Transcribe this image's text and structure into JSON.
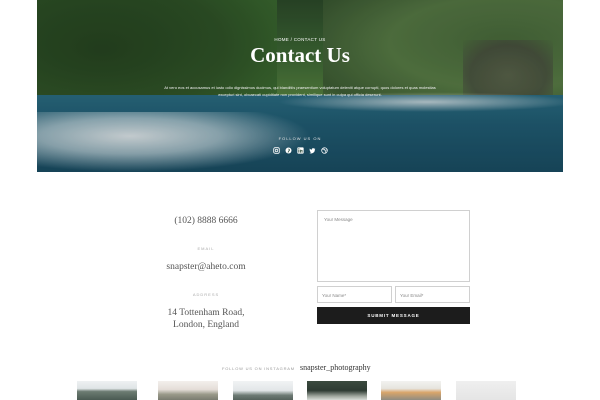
{
  "hero": {
    "breadcrumb": "HOME / CONTACT US",
    "title": "Contact Us",
    "intro": "At vero eos et accusamus et iusto odio dignissimos ducimus, qui blanditiis praesentium voluptatum deleniti atque corrupti, quos dolores et quas molestias excepturi sint, obcaecati cupiditate non provident, similique sunt in culpa qui officia deserunt.",
    "follow_label": "FOLLOW US ON",
    "socials": [
      "instagram-icon",
      "pinterest-icon",
      "linkedin-icon",
      "twitter-icon",
      "dribbble-icon"
    ]
  },
  "contact": {
    "phone": "(102) 8888 6666",
    "email_label": "EMAIL",
    "email": "snapster@aheto.com",
    "address_label": "ADDRESS",
    "address_line1": "14 Tottenham Road,",
    "address_line2": "London, England"
  },
  "form": {
    "message_placeholder": "Your Message",
    "name_placeholder": "Your Name*",
    "email_placeholder": "Your Email*",
    "submit_label": "SUBMIT MESSAGE"
  },
  "instagram": {
    "label": "FOLLOW US ON INSTAGRAM",
    "handle": "snapster_photography"
  },
  "colors": {
    "button": "#1c1c1c",
    "border": "#d0d0d0",
    "text": "#555555"
  }
}
